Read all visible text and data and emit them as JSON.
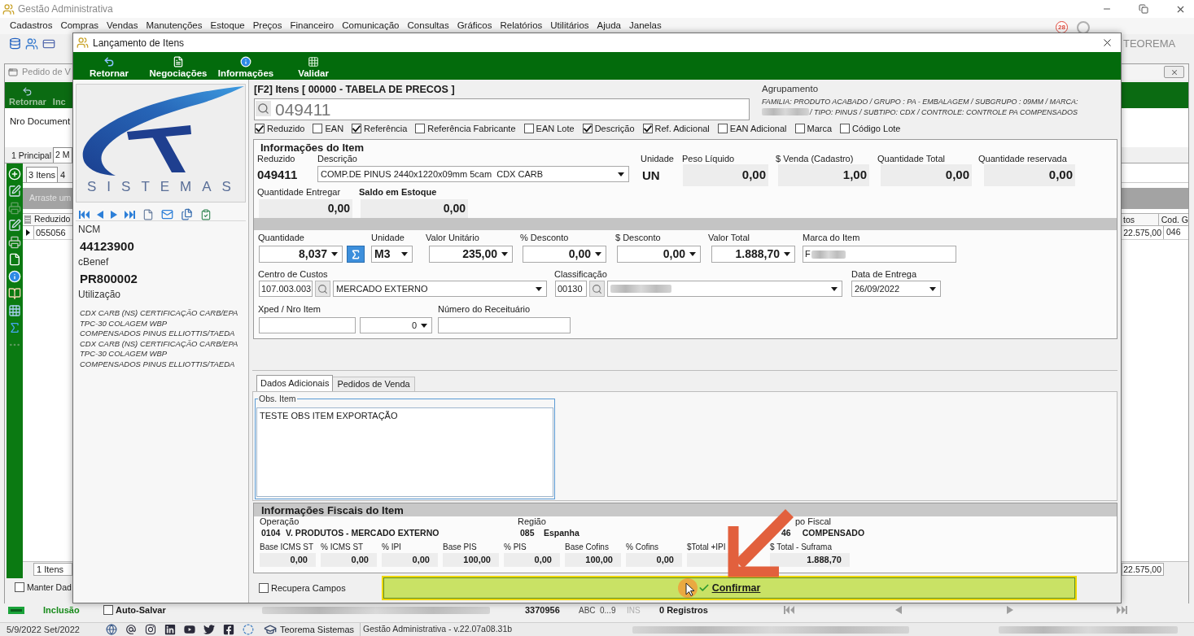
{
  "app": {
    "title": "Gestão Administrativa",
    "menu": [
      "Cadastros",
      "Compras",
      "Vendas",
      "Manutenções",
      "Estoque",
      "Preços",
      "Financeiro",
      "Comunicação",
      "Consultas",
      "Gráficos",
      "Relatórios",
      "Utilitários",
      "Ajuda",
      "Janelas"
    ],
    "notification_count": "28",
    "brand": "TEOREMA"
  },
  "order_window": {
    "title": "Pedido de V",
    "toolbar": [
      "Retornar",
      "Inc"
    ],
    "document_label": "Nro Document",
    "tabs": [
      {
        "label": "1 Principal",
        "selected": false
      },
      {
        "label": "2 M",
        "selected": true
      }
    ],
    "sub_tabs": [
      {
        "label": "3 Itens",
        "selected": true
      },
      {
        "label": "4",
        "selected": false
      }
    ],
    "group_hint": "Arraste um",
    "grid": {
      "columns": [
        "Reduzido",
        "tos",
        "Cod. G"
      ],
      "rows": [
        {
          "cells": [
            "055056",
            "22.575,00",
            "046"
          ],
          "selected": true
        }
      ],
      "footer_count": "1 Itens",
      "footer_total": "22.575,00"
    },
    "keep_data": {
      "label": "Manter Dad",
      "checked": false
    }
  },
  "dialog": {
    "title": "Lançamento de Itens",
    "toolbar": [
      {
        "label": "Retornar",
        "kind": "back"
      },
      {
        "label": "Negociações",
        "kind": "document"
      },
      {
        "label": "Informações",
        "kind": "info"
      },
      {
        "label": "Validar",
        "kind": "grid"
      }
    ],
    "logo_text": "SISTEMAS",
    "ncm": {
      "label": "NCM",
      "value": "44123900"
    },
    "cbenef": {
      "label": "cBenef",
      "value": "PR800002"
    },
    "usage": {
      "label": "Utilização",
      "lines": [
        "CDX CARB (NS) CERTIFICAÇÃO CARB/EPA",
        "TPC-30 COLAGEM WBP",
        "COMPENSADOS PINUS ELLIOTTIS/TAEDA",
        "CDX CARB (NS) CERTIFICAÇÃO CARB/EPA",
        "TPC-30 COLAGEM WBP",
        "COMPENSADOS PINUS ELLIOTTIS/TAEDA"
      ]
    },
    "search": {
      "title": "[F2] Itens [ 00000 - TABELA DE PRECOS ]",
      "placeholder": "049411"
    },
    "grouping": {
      "label": "Agrupamento",
      "lines": [
        "FAMILIA: PRODUTO ACABADO / GRUPO : PA - EMBALAGEM / SUBGRUPO : 09MM / MARCA:",
        "/ TIPO: PINUS / SUBTIPO: CDX / CONTROLE: CONTROLE PA COMPENSADOS"
      ]
    },
    "search_options": [
      {
        "label": "Reduzido",
        "checked": true
      },
      {
        "label": "EAN",
        "checked": false
      },
      {
        "label": "Referência",
        "checked": true
      },
      {
        "label": "Referência Fabricante",
        "checked": false
      },
      {
        "label": "EAN Lote",
        "checked": false
      },
      {
        "label": "Descrição",
        "checked": true
      },
      {
        "label": "Ref. Adicional",
        "checked": true
      },
      {
        "label": "EAN Adicional",
        "checked": false
      },
      {
        "label": "Marca",
        "checked": false
      },
      {
        "label": "Código Lote",
        "checked": false
      }
    ],
    "item_info": {
      "title": "Informações do Item",
      "code": {
        "label": "Reduzido",
        "value": "049411"
      },
      "description": {
        "label": "Descrição",
        "value": "COMP.DE PINUS 2440x1220x09mm 5cam  CDX CARB"
      },
      "unit": {
        "label": "Unidade",
        "value": "UN"
      },
      "figures": [
        {
          "label": "Peso Líquido",
          "value": "0,00"
        },
        {
          "label": "$ Venda (Cadastro)",
          "value": "1,00"
        },
        {
          "label": "Quantidade Total",
          "value": "0,00"
        },
        {
          "label": "Quantidade reservada",
          "value": "0,00"
        }
      ],
      "stock": [
        {
          "label": "Quantidade Entregar",
          "value": "0,00"
        },
        {
          "label": "Saldo em Estoque",
          "value": "0,00"
        }
      ]
    },
    "entry": {
      "quantity": {
        "label": "Quantidade",
        "value": "8,037"
      },
      "unit": {
        "label": "Unidade",
        "value": "M3"
      },
      "amounts": [
        {
          "label": "Valor Unitário",
          "value": "235,00"
        },
        {
          "label": "% Desconto",
          "value": "0,00"
        },
        {
          "label": "$ Desconto",
          "value": "0,00"
        },
        {
          "label": "Valor Total",
          "value": "1.888,70"
        }
      ],
      "brand": {
        "label": "Marca do Item",
        "value": "F"
      },
      "cost_center": {
        "label": "Centro de Custos",
        "code": "107.003.003",
        "value": "MERCADO EXTERNO"
      },
      "classification": {
        "label": "Classificação",
        "code": "00130"
      },
      "delivery_date": {
        "label": "Data de Entrega",
        "value": "26/09/2022"
      },
      "xped": {
        "label": "Xped / Nro Item",
        "item": "0"
      },
      "prescription": {
        "label": "Número do Receituário"
      }
    },
    "tabs": [
      {
        "label": "Dados Adicionais",
        "selected": true
      },
      {
        "label": "Pedidos de Venda",
        "selected": false
      }
    ],
    "notes": {
      "label": "Obs. Item",
      "value": "TESTE OBS ITEM EXPORTAÇÃO"
    },
    "fiscal": {
      "title": "Informações Fiscais do Item",
      "operation": {
        "label": "Operação",
        "code": "0104",
        "value": "V. PRODUTOS - MERCADO EXTERNO"
      },
      "region": {
        "label": "Região",
        "code": "085",
        "value": "Espanha"
      },
      "fiscal_type": {
        "label": "po Fiscal",
        "code": "46",
        "value": "COMPENSADO"
      },
      "taxes": [
        {
          "label": "Base ICMS ST",
          "value": "0,00"
        },
        {
          "label": "% ICMS ST",
          "value": "0,00"
        },
        {
          "label": "% IPI",
          "value": "0,00"
        },
        {
          "label": "Base PIS",
          "value": "100,00"
        },
        {
          "label": "% PIS",
          "value": "0,00"
        },
        {
          "label": "Base Cofins",
          "value": "100,00"
        },
        {
          "label": "% Cofins",
          "value": "0,00"
        },
        {
          "label": "$Total +IPI"
        },
        {
          "label": "$ Total - Suframa",
          "value": "1.888,70"
        }
      ]
    },
    "recover_fields": {
      "label": "Recupera Campos",
      "checked": false
    },
    "confirm": "Confirmar"
  },
  "status_bar": {
    "mode": "Inclusão",
    "auto_save": {
      "label": "Auto-Salvar",
      "checked": false
    },
    "record_id": "3370956",
    "indicators": [
      {
        "label": "ABC",
        "on": true
      },
      {
        "label": "0...9",
        "on": true
      },
      {
        "label": "INS",
        "on": false
      }
    ],
    "records": "0 Registros"
  },
  "taskbar": {
    "period": "5/9/2022 Set/2022",
    "company": "Teorema Sistemas",
    "version": "Gestão Administrativa - v.22.07a08.31b"
  }
}
